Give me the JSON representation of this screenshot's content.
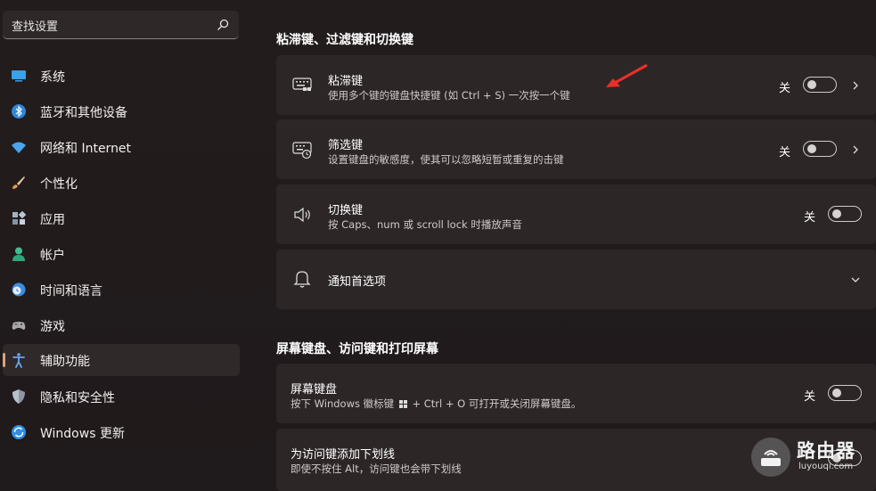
{
  "search": {
    "placeholder": "查找设置",
    "icon": "search-icon"
  },
  "sidebar": {
    "items": [
      {
        "label": "系统",
        "icon": "display-icon",
        "color": "#3aa0e8"
      },
      {
        "label": "蓝牙和其他设备",
        "icon": "bluetooth-icon",
        "color": "#2f87d8"
      },
      {
        "label": "网络和 Internet",
        "icon": "wifi-icon",
        "color": "#4aa6ee"
      },
      {
        "label": "个性化",
        "icon": "brush-icon",
        "color": "#e49a4b"
      },
      {
        "label": "应用",
        "icon": "apps-icon",
        "color": "#9fb2c6"
      },
      {
        "label": "帐户",
        "icon": "person-icon",
        "color": "#3fbf8f"
      },
      {
        "label": "时间和语言",
        "icon": "clock-globe-icon",
        "color": "#3b8fe0"
      },
      {
        "label": "游戏",
        "icon": "gamepad-icon",
        "color": "#a7a7a7"
      },
      {
        "label": "辅助功能",
        "icon": "accessibility-icon",
        "color": "#6aa8f2",
        "active": true
      },
      {
        "label": "隐私和安全性",
        "icon": "shield-icon",
        "color": "#8d96a2"
      },
      {
        "label": "Windows 更新",
        "icon": "update-icon",
        "color": "#2f8fe6"
      }
    ]
  },
  "main": {
    "section1_title": "粘滞键、过滤键和切换键",
    "section2_title": "屏幕键盘、访问键和打印屏幕",
    "cards": {
      "sticky": {
        "title": "粘滞键",
        "desc": "使用多个键的键盘快捷键 (如 Ctrl + S) 一次按一个键",
        "state": "关"
      },
      "filter": {
        "title": "筛选键",
        "desc": "设置键盘的敏感度，使其可以忽略短暂或重复的击键",
        "state": "关"
      },
      "toggle": {
        "title": "切换键",
        "desc": "按 Caps、num 或 scroll lock 时播放声音",
        "state": "关"
      },
      "notify": {
        "title": "通知首选项"
      },
      "osk": {
        "title": "屏幕键盘",
        "desc_prefix": "按下 Windows 徽标键",
        "desc_suffix": "+ Ctrl + O 可打开或关闭屏幕键盘。",
        "state": "关"
      },
      "underline": {
        "title": "为访问键添加下划线",
        "desc": "即使不按住 Alt，访问键也会带下划线"
      }
    }
  },
  "watermark": {
    "title": "路由器",
    "subtitle": "luyouqi.com"
  },
  "colors": {
    "accent": "#d8a47d",
    "arrow": "#e8302a",
    "card": "#2c2627"
  }
}
